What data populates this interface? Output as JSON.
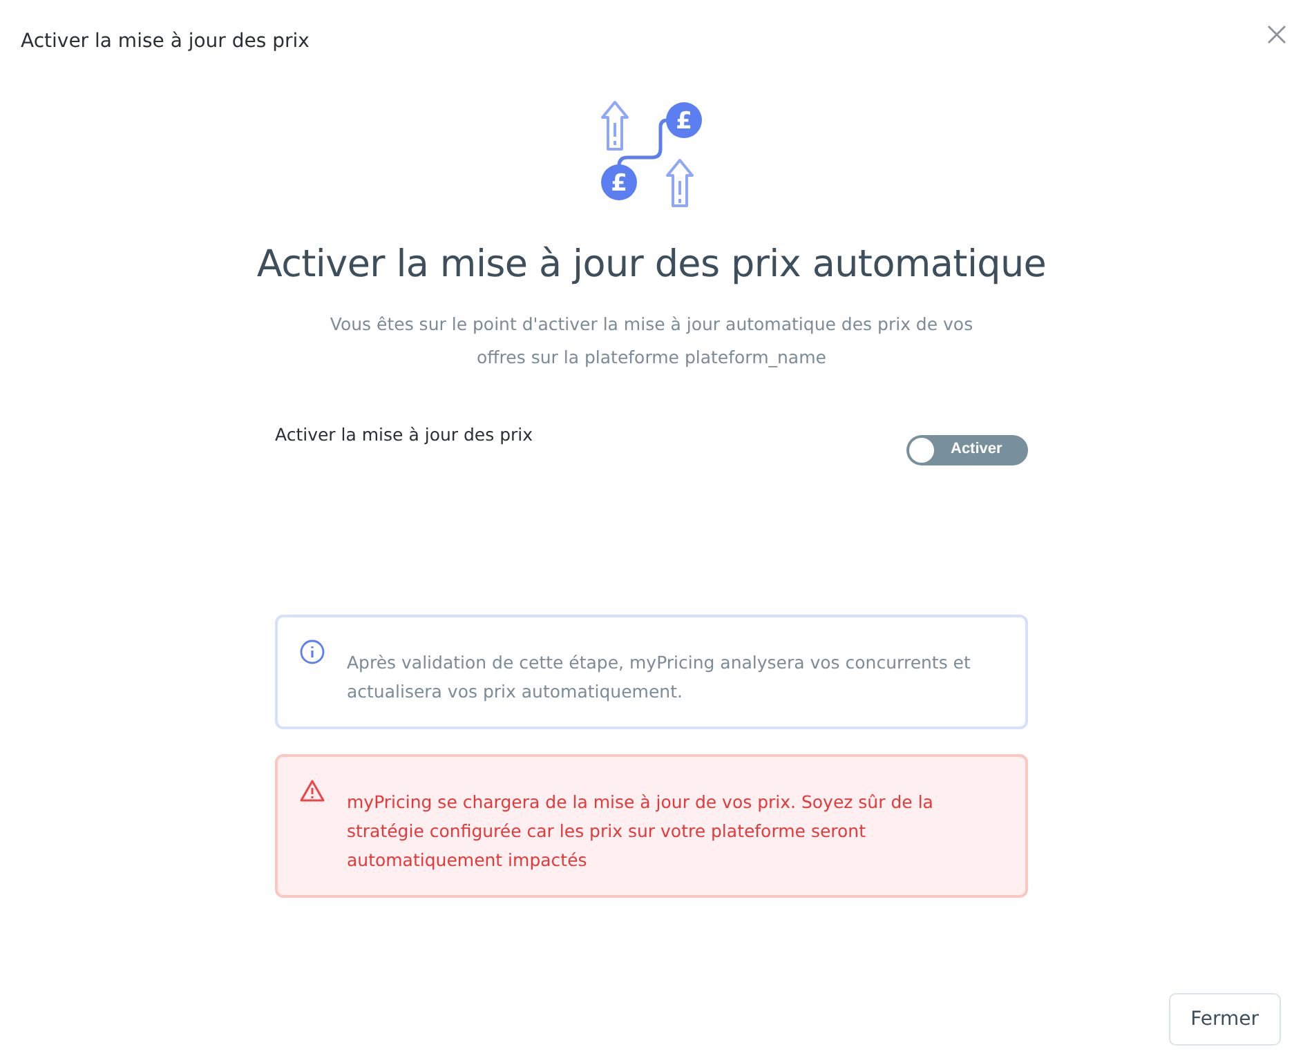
{
  "dialog": {
    "title": "Activer la mise à jour des prix"
  },
  "illustration": {
    "currency_symbols": [
      "£",
      "£"
    ]
  },
  "heading": "Activer la mise à jour des prix automatique",
  "description": "Vous êtes sur le point d'activer la mise à jour automatique des prix de vos offres sur la plateforme plateform_name",
  "setting": {
    "label": "Activer la mise à jour des prix",
    "toggle_label": "Activer",
    "on": false
  },
  "alerts": [
    {
      "kind": "info",
      "text": "Après validation de cette étape, myPricing analysera vos concurrents et actualisera vos prix automatiquement."
    },
    {
      "kind": "warning",
      "text": "myPricing se chargera de la mise à jour de vos prix. Soyez sûr de la stratégie configurée car les prix sur votre plateforme seront automatiquement impactés"
    }
  ],
  "buttons": [
    "Fermer"
  ]
}
